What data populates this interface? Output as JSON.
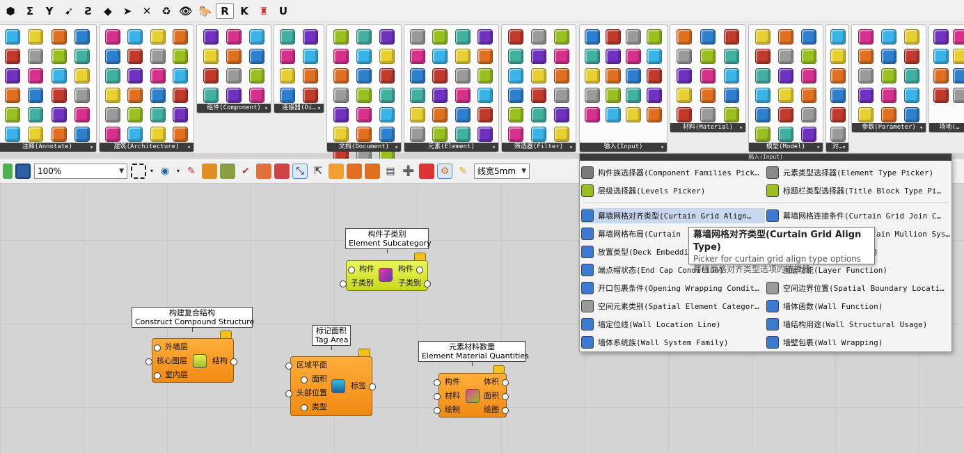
{
  "tabs": [
    {
      "label": "⬢",
      "icon": "hex-shape-icon"
    },
    {
      "label": "Σ",
      "icon": "sigma-icon"
    },
    {
      "label": "Y",
      "icon": "vector-icon"
    },
    {
      "label": "➹",
      "icon": "curve-icon"
    },
    {
      "label": "Ƨ",
      "icon": "surface-icon"
    },
    {
      "label": "◆",
      "icon": "mesh-icon"
    },
    {
      "label": "➤",
      "icon": "intersect-icon"
    },
    {
      "label": "✕",
      "icon": "transform-icon"
    },
    {
      "label": "♻",
      "icon": "display-icon"
    },
    {
      "label": "👁",
      "icon": "eye-icon"
    },
    {
      "label": "🐎",
      "icon": "horse-icon"
    },
    {
      "label": "R",
      "icon": "rhino-inside-icon",
      "active": true
    },
    {
      "label": "K",
      "icon": "k-plugin-icon"
    },
    {
      "label": "♜",
      "icon": "red-plugin-icon"
    },
    {
      "label": "U",
      "icon": "u-plugin-icon"
    }
  ],
  "ribbon": {
    "panels": [
      {
        "label": "注释(Annotate)"
      },
      {
        "label": "建筑(Architecture)"
      },
      {
        "label": "组件(Component)"
      },
      {
        "label": "连接器(Di…"
      },
      {
        "label": "文档(Document)"
      },
      {
        "label": "元素(Element)"
      },
      {
        "label": "筛选器(Filter)"
      },
      {
        "label": "输入(Input)"
      },
      {
        "label": "材料(Material)"
      },
      {
        "label": "模型(Model)"
      },
      {
        "label": "对…"
      },
      {
        "label": "参数(Parameter)"
      },
      {
        "label": "场地(…"
      }
    ]
  },
  "toolbar": {
    "zoom": "100%",
    "line_width": "线宽5mm"
  },
  "components": [
    {
      "title_cn": "构件子类别",
      "title_en": "Element Subcategory",
      "inputs": [
        "构件",
        "子类别"
      ],
      "outputs": [
        "构件",
        "子类别"
      ]
    },
    {
      "title_cn": "构建复合结构",
      "title_en": "Construct Compound Structure",
      "inputs": [
        "外墙层",
        "核心图层",
        "室内层"
      ],
      "outputs": [
        "结构"
      ]
    },
    {
      "title_cn": "标记面积",
      "title_en": "Tag Area",
      "inputs": [
        "区域平面",
        "面积",
        "头部位置",
        "类型"
      ],
      "outputs": [
        "标签"
      ]
    },
    {
      "title_cn": "元素材料数量",
      "title_en": "Element Material Quantities",
      "inputs": [
        "构件",
        "材料",
        "绘制"
      ],
      "outputs": [
        "体积",
        "面积",
        "绘图"
      ]
    }
  ],
  "dropdown": {
    "header": "输入(Input)",
    "items": [
      {
        "label": "构件族选择器(Component Families Pick…",
        "icon": "family-picker-icon"
      },
      {
        "label": "元素类型选择器(Element Type Picker)",
        "icon": "type-picker-icon"
      },
      {
        "label": "层级选择器(Levels Picker)",
        "icon": "levels-picker-icon"
      },
      {
        "label": "标题栏类型选择器(Title Block Type Pi…",
        "icon": "title-block-icon"
      },
      {
        "label": "幕墙网格对齐类型(Curtain Grid Align…",
        "icon": "curtain-align-icon"
      },
      {
        "label": "幕墙网格连接条件(Curtain Grid Join C…",
        "icon": "curtain-join-icon"
      },
      {
        "label": "幕墙网格布局(Curtain",
        "icon": "curtain-layout-icon"
      },
      {
        "label": "ain Mullion Sys…",
        "icon": "mullion-icon"
      },
      {
        "label": "放置类型(Deck Embeddi",
        "icon": "deck-icon"
      },
      {
        "label": ")",
        "icon": "blank-icon"
      },
      {
        "label": "端点帽状态(End Cap Condition)",
        "icon": "end-cap-icon"
      },
      {
        "label": "图层功能(Layer Function)",
        "icon": "layer-function-icon"
      },
      {
        "label": "开口包裹条件(Opening Wrapping Condit…",
        "icon": "opening-wrap-icon"
      },
      {
        "label": "空间边界位置(Spatial Boundary Locati…",
        "icon": "spatial-boundary-icon"
      },
      {
        "label": "空间元素类别(Spatial Element Categor…",
        "icon": "spatial-element-icon"
      },
      {
        "label": "墙体函数(Wall Function)",
        "icon": "wall-function-icon"
      },
      {
        "label": "墙定位线(Wall Location Line)",
        "icon": "wall-location-icon"
      },
      {
        "label": "墙结构用途(Wall Structural Usage)",
        "icon": "wall-structural-icon"
      },
      {
        "label": "墙体系统族(Wall System Family)",
        "icon": "wall-system-icon"
      },
      {
        "label": "墙壁包裹(Wall Wrapping)",
        "icon": "wall-wrapping-icon"
      }
    ]
  },
  "tooltip": {
    "title": "幕墙网格对齐类型(Curtain Grid Align Type)",
    "line1": "Picker for curtain grid align type options",
    "line2": "幕墙面格对齐类型选项的选择器"
  },
  "colors": {
    "component_orange": "#f59a22",
    "component_yellow": "#dbe83a",
    "highlight": "#c8d8ee",
    "accent_blue": "#1f5fa8"
  }
}
